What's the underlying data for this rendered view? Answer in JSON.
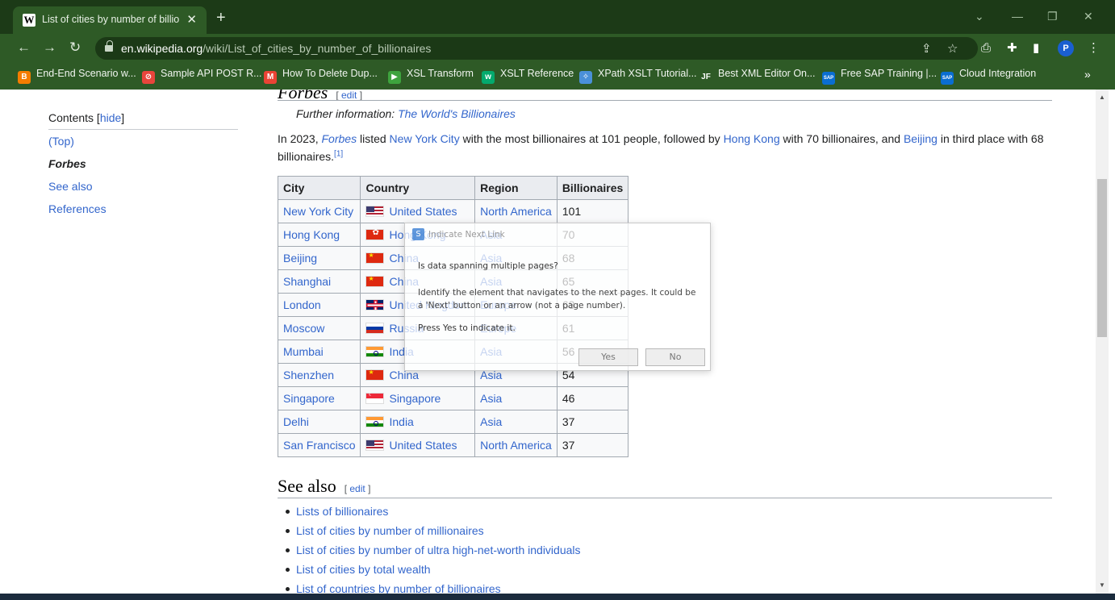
{
  "browser": {
    "tab_title": "List of cities by number of billion...",
    "tab_favicon": "W",
    "url_host": "en.wikipedia.org",
    "url_path": "/wiki/List_of_cities_by_number_of_billionaires",
    "profile_initial": "P",
    "bookmarks": [
      {
        "label": "End-End Scenario w...",
        "icon": "blogger-icon",
        "color": "#f57d00",
        "glyph": "B"
      },
      {
        "label": "Sample API POST R...",
        "icon": "postman-icon",
        "color": "#e8453c",
        "glyph": "⊘"
      },
      {
        "label": "How To Delete Dup...",
        "icon": "gmail-icon",
        "color": "#ea4335",
        "glyph": "M"
      },
      {
        "label": "XSL Transform",
        "icon": "play-icon",
        "color": "#3ea33e",
        "glyph": "▶"
      },
      {
        "label": "XSLT Reference",
        "icon": "w3-icon",
        "color": "#04aa6d",
        "glyph": "w"
      },
      {
        "label": "XPath XSLT Tutorial...",
        "icon": "sparkle-icon",
        "color": "#4a90d9",
        "glyph": "✧"
      },
      {
        "label": "Best XML Editor On...",
        "icon": "jf-icon",
        "color": "#2e5a26",
        "glyph": "JF"
      },
      {
        "label": "Free SAP Training |...",
        "icon": "sap-icon",
        "color": "#0a6ed1",
        "glyph": "SAP"
      },
      {
        "label": "Cloud Integration",
        "icon": "sap-icon",
        "color": "#0a6ed1",
        "glyph": "SAP"
      }
    ],
    "bookmarks_more": "»"
  },
  "toc": {
    "title": "Contents",
    "hide": "hide",
    "items": [
      "(Top)",
      "Forbes",
      "See also",
      "References"
    ]
  },
  "article": {
    "section_heading": "Forbes",
    "edit_label": "edit",
    "hatnote_prefix": "Further information: ",
    "hatnote_link": "The World's Billionaires",
    "para": {
      "t1": "In 2023, ",
      "forbes": "Forbes",
      "t2": " listed ",
      "nyc": "New York City",
      "t3": " with the most billionaires at 101 people, followed by ",
      "hk": "Hong Kong",
      "t4": " with 70 billionaires, and ",
      "bj": "Beijing",
      "t5": " in third place with 68 billionaires.",
      "ref": "[1]"
    },
    "table": {
      "headers": [
        "City",
        "Country",
        "Region",
        "Billionaires"
      ],
      "rows": [
        {
          "city": "New York City",
          "country": "United States",
          "flag": "us",
          "region": "North America",
          "count": "101"
        },
        {
          "city": "Hong Kong",
          "country": "Hong Kong",
          "flag": "hk",
          "region": "Asia",
          "count": "70"
        },
        {
          "city": "Beijing",
          "country": "China",
          "flag": "cn",
          "region": "Asia",
          "count": "68"
        },
        {
          "city": "Shanghai",
          "country": "China",
          "flag": "cn",
          "region": "Asia",
          "count": "65"
        },
        {
          "city": "London",
          "country": "United Kingdom",
          "flag": "gb",
          "region": "Europe",
          "count": "63"
        },
        {
          "city": "Moscow",
          "country": "Russia",
          "flag": "ru",
          "region": "Europe",
          "count": "61"
        },
        {
          "city": "Mumbai",
          "country": "India",
          "flag": "in",
          "region": "Asia",
          "count": "56"
        },
        {
          "city": "Shenzhen",
          "country": "China",
          "flag": "cn",
          "region": "Asia",
          "count": "54"
        },
        {
          "city": "Singapore",
          "country": "Singapore",
          "flag": "sg",
          "region": "Asia",
          "count": "46"
        },
        {
          "city": "Delhi",
          "country": "India",
          "flag": "in",
          "region": "Asia",
          "count": "37"
        },
        {
          "city": "San Francisco",
          "country": "United States",
          "flag": "us",
          "region": "North America",
          "count": "37"
        }
      ]
    },
    "see_also_heading": "See also",
    "see_also": [
      "Lists of billionaires",
      "List of cities by number of millionaires",
      "List of cities by number of ultra high-net-worth individuals",
      "List of cities by total wealth",
      "List of countries by number of billionaires"
    ]
  },
  "dialog": {
    "title": "Indicate Next Link",
    "question": "Is data spanning multiple pages?",
    "body": "Identify the element that navigates to the next pages. It could be a 'Next' button or an arrow (not a page number).",
    "press": "Press Yes to indicate it.",
    "yes": "Yes",
    "no": "No"
  }
}
